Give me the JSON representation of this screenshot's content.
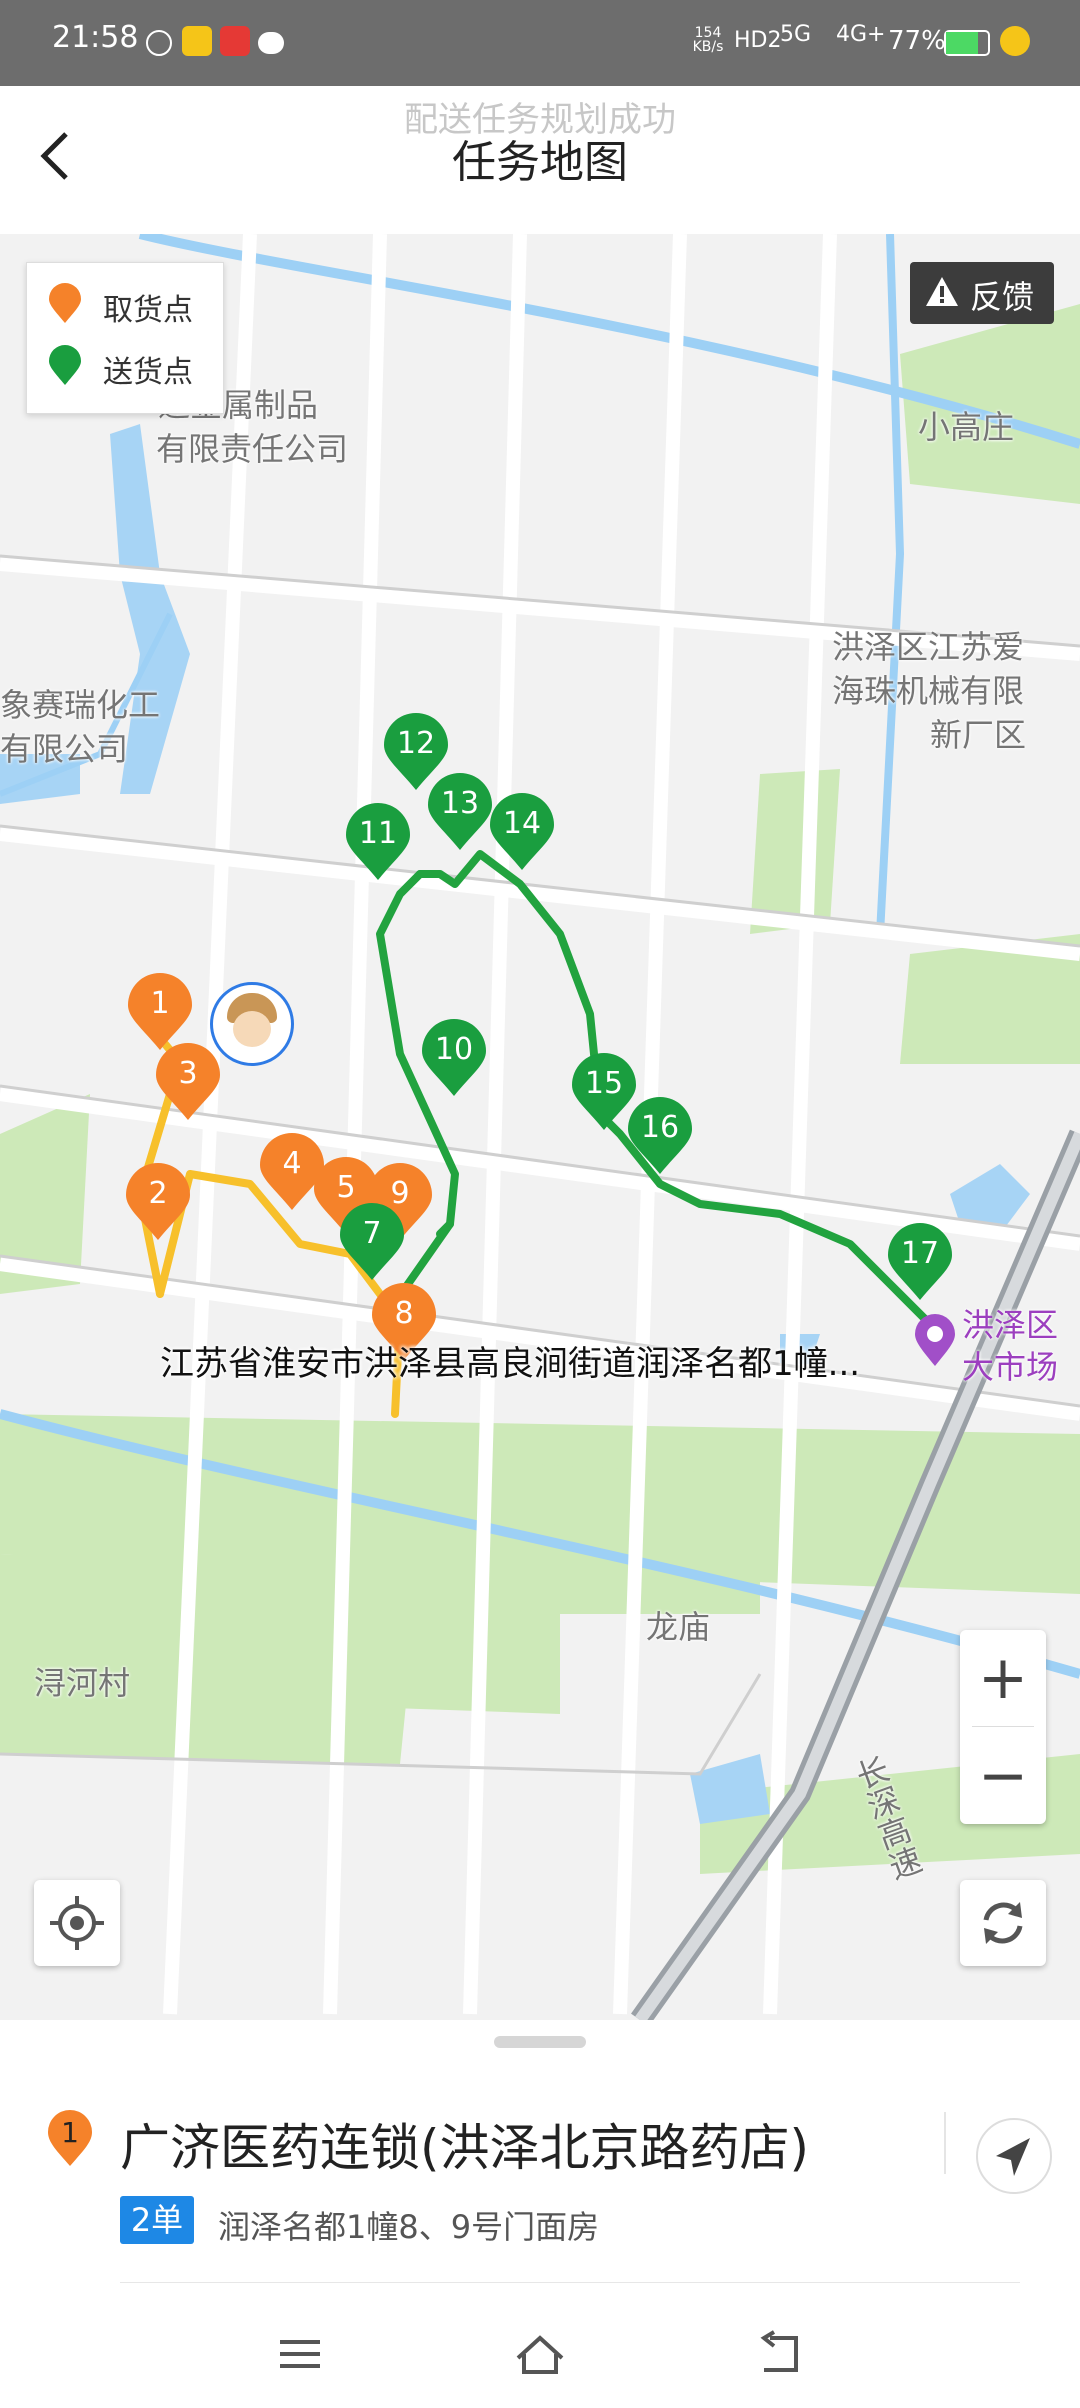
{
  "status_bar": {
    "time": "21:58",
    "net_speed": "154\nKB/s",
    "signal_labels": [
      "HD2",
      "5G",
      "4G+"
    ],
    "battery": "77%"
  },
  "header": {
    "title": "任务地图",
    "toast": "配送任务规划成功"
  },
  "legend": {
    "pickup": "取货点",
    "delivery": "送货点",
    "pickup_color": "#f5822a",
    "delivery_color": "#1a9e3f"
  },
  "feedback_label": "反馈",
  "map": {
    "places": [
      "通金属制品",
      "有限责任公司",
      "小高庄",
      "洪泽区江苏爱",
      "海珠机械有限",
      "新厂区",
      "象赛瑞化工",
      "有限公司",
      "洪泽区",
      "大市场",
      "龙庙",
      "浔河村",
      "长深高速"
    ],
    "address_label": "江苏省淮安市洪泽县高良涧街道润泽名都1幢...",
    "pickup_markers": [
      "1",
      "3",
      "2",
      "4",
      "5",
      "9",
      "8"
    ],
    "delivery_markers": [
      "12",
      "13",
      "14",
      "11",
      "10",
      "15",
      "16",
      "7",
      "17"
    ]
  },
  "zoom": {
    "plus": "+",
    "minus": "−"
  },
  "stop": {
    "index": "1",
    "name": "广济医药连锁(洪泽北京路药店)",
    "orders": "2单",
    "address": "润泽名都1幢8、9号门面房"
  }
}
